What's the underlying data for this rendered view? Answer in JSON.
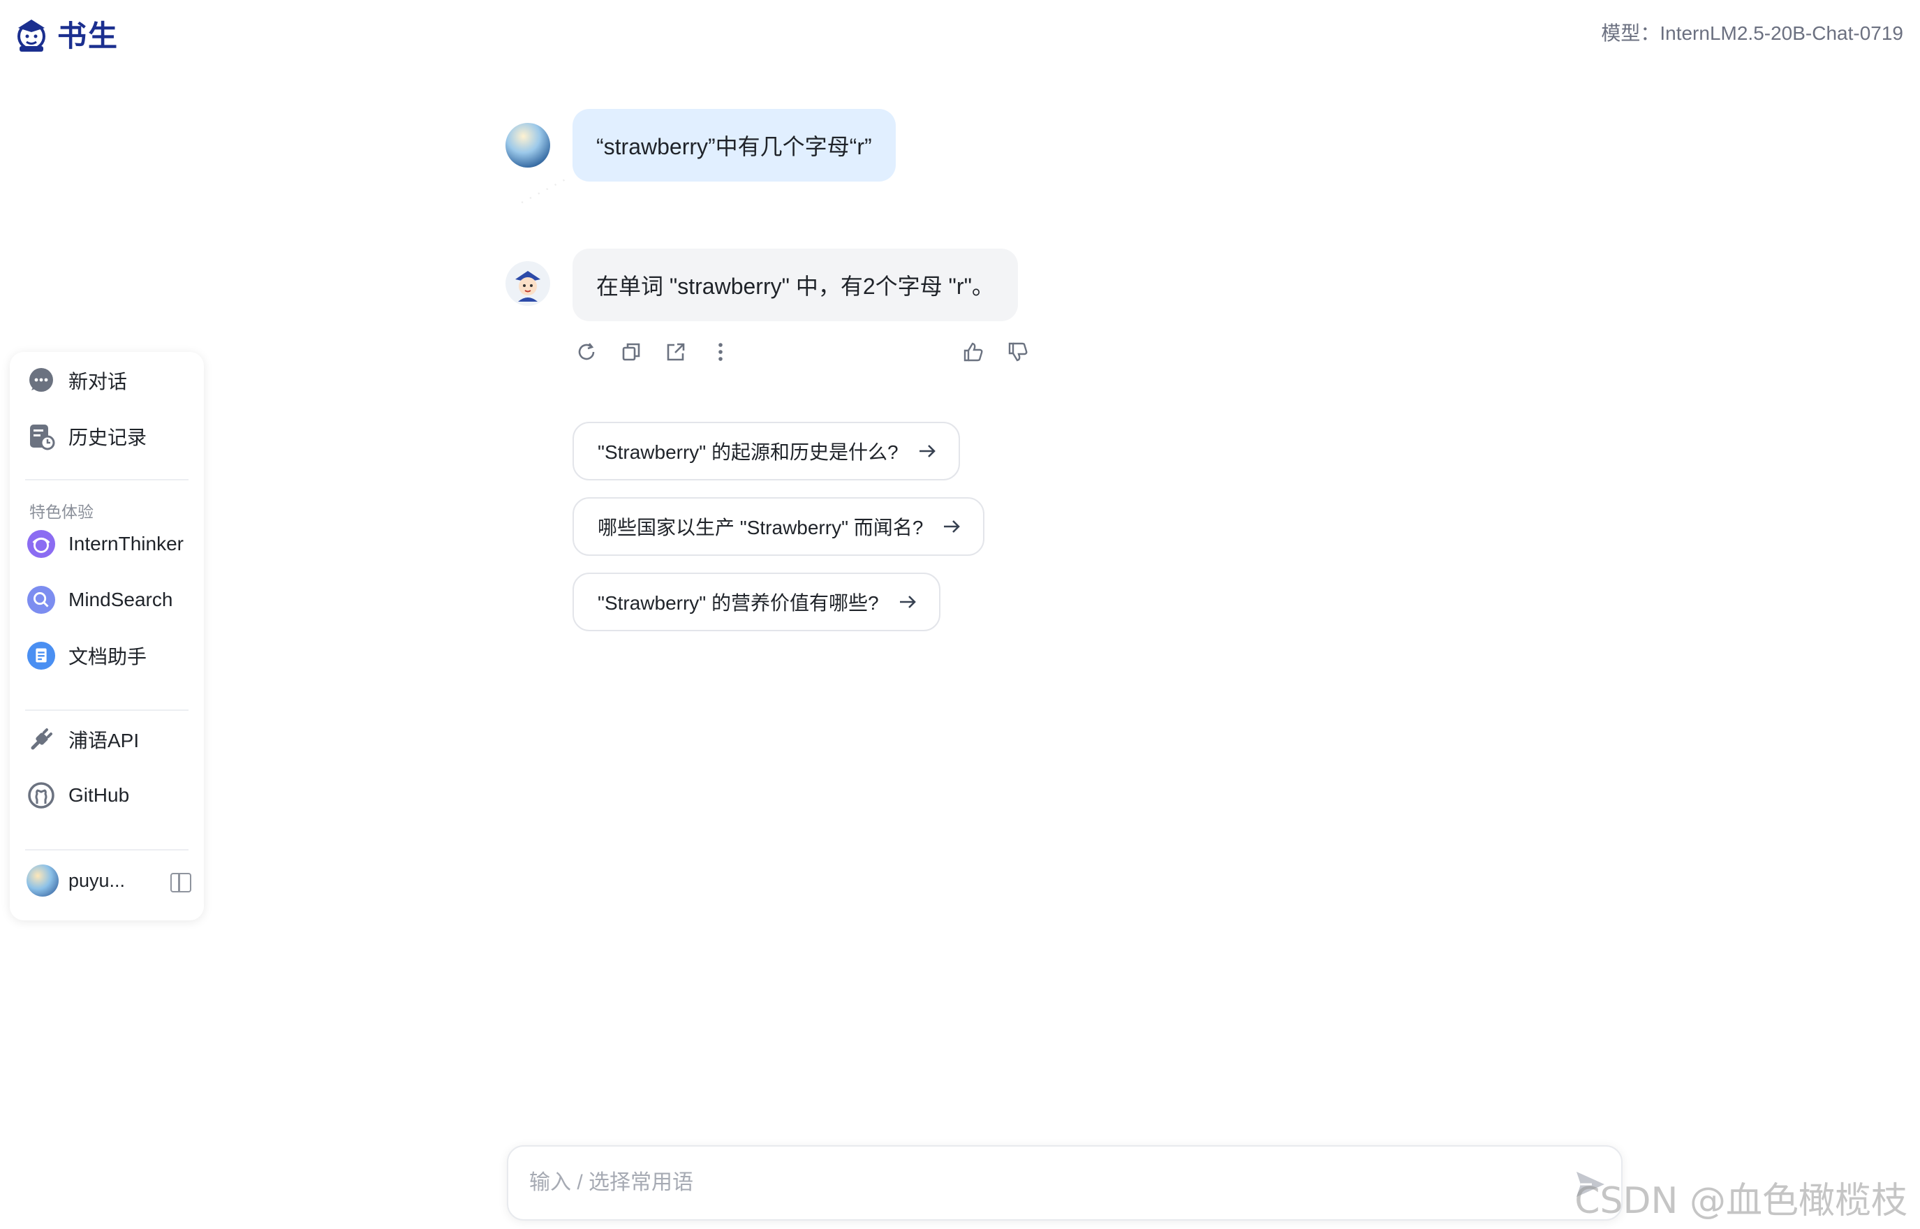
{
  "header": {
    "logo_text": "书生",
    "model_label": "模型：InternLM2.5-20B-Chat-0719"
  },
  "sidebar": {
    "items_top": [
      {
        "label": "新对话",
        "icon": "chat-bubble-icon"
      },
      {
        "label": "历史记录",
        "icon": "history-icon"
      }
    ],
    "section_title": "特色体验",
    "features": [
      {
        "label": "InternThinker",
        "icon": "intern-thinker-icon"
      },
      {
        "label": "MindSearch",
        "icon": "mindsearch-icon"
      },
      {
        "label": "文档助手",
        "icon": "document-assistant-icon"
      }
    ],
    "links": [
      {
        "label": "浦语API",
        "icon": "plug-icon"
      },
      {
        "label": "GitHub",
        "icon": "github-icon"
      }
    ],
    "user": {
      "name": "puyu..."
    }
  },
  "chat": {
    "user_message": "“strawberry”中有几个字母“r”",
    "bot_message": "在单词 \"strawberry\" 中，有2个字母 \"r\"。",
    "suggestions": [
      "\"Strawberry\" 的起源和历史是什么?",
      "哪些国家以生产 \"Strawberry\" 而闻名?",
      "\"Strawberry\" 的营养价值有哪些?"
    ]
  },
  "input": {
    "placeholder": "输入 / 选择常用语"
  },
  "watermark": "CSDN @血色橄榄枝",
  "colors": {
    "user_bubble": "#e1efff",
    "bot_bubble": "#f3f4f6",
    "brand": "#1b2f8f"
  }
}
